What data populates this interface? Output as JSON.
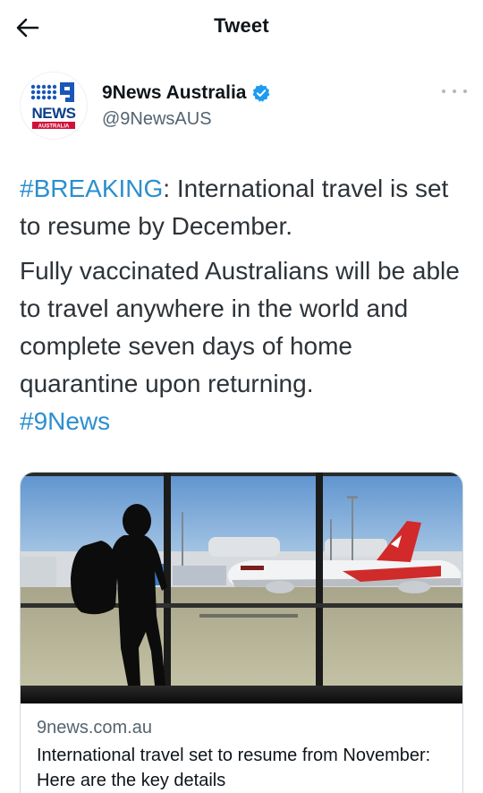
{
  "header": {
    "title": "Tweet"
  },
  "author": {
    "avatar_logo_text": "NEWS",
    "avatar_logo_sub": "AUSTRALIA",
    "display_name": "9News Australia",
    "handle": "@9NewsAUS",
    "verified": true
  },
  "tweet": {
    "p1_hashtag": "#BREAKING",
    "p1_text": ": International travel is set to resume by December.",
    "p2_text": "Fully vaccinated Australians will be able to travel anywhere in the world and complete seven days of home quarantine upon returning.",
    "p2_hashtag": "#9News"
  },
  "card": {
    "domain": "9news.com.au",
    "title": "International travel set to resume from November: Here are the key details"
  },
  "icons": {
    "back": "arrow-left-icon",
    "verified": "verified-badge-icon",
    "more": "more-horizontal-icon"
  },
  "colors": {
    "link": "#2b8fcf",
    "verified": "#1d9bf0",
    "secondary_text": "#536471",
    "brand_red": "#d0103a",
    "brand_blue": "#0d3d8c"
  }
}
